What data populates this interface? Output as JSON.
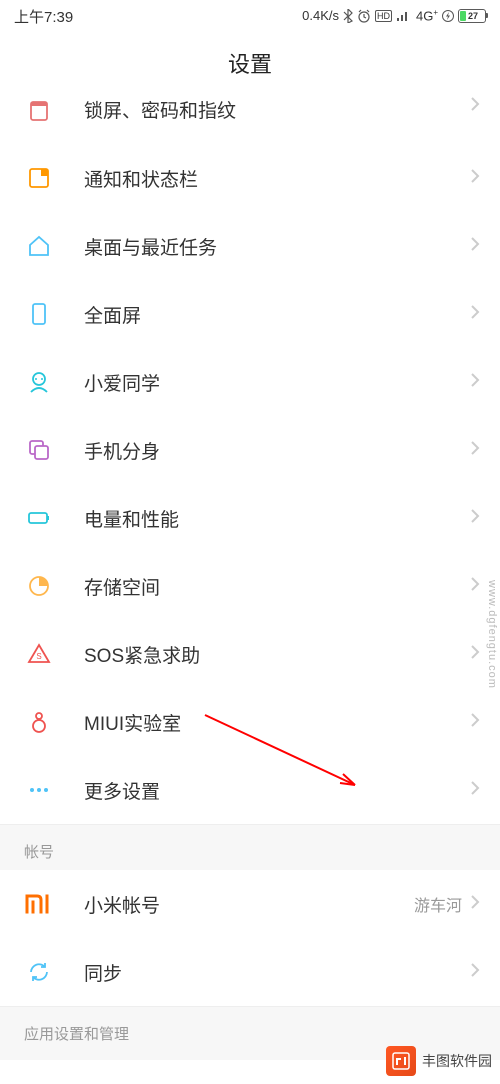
{
  "status": {
    "time": "上午7:39",
    "speed": "0.4K/s",
    "signal": "4G",
    "battery_pct": "27"
  },
  "header": {
    "title": "设置"
  },
  "items": [
    {
      "icon": "lock",
      "color": "#e57373",
      "label": "锁屏、密码和指纹"
    },
    {
      "icon": "notification",
      "color": "#ff9800",
      "label": "通知和状态栏"
    },
    {
      "icon": "home",
      "color": "#4fc3f7",
      "label": "桌面与最近任务"
    },
    {
      "icon": "fullscreen",
      "color": "#4fc3f7",
      "label": "全面屏"
    },
    {
      "icon": "xiaoai",
      "color": "#26c6da",
      "label": "小爱同学"
    },
    {
      "icon": "dual",
      "color": "#ba68c8",
      "label": "手机分身"
    },
    {
      "icon": "battery-perf",
      "color": "#26c6da",
      "label": "电量和性能"
    },
    {
      "icon": "storage",
      "color": "#ffb74d",
      "label": "存储空间"
    },
    {
      "icon": "sos",
      "color": "#ef5350",
      "label": "SOS紧急求助"
    },
    {
      "icon": "lab",
      "color": "#ef5350",
      "label": "MIUI实验室"
    },
    {
      "icon": "more",
      "color": "#4fc3f7",
      "label": "更多设置"
    }
  ],
  "section_account": "帐号",
  "account_items": [
    {
      "icon": "mi",
      "color": "#ff6f00",
      "label": "小米帐号",
      "value": "游车河"
    },
    {
      "icon": "sync",
      "color": "#4fc3f7",
      "label": "同步"
    }
  ],
  "section_apps": "应用设置和管理",
  "watermark": "www.dgfengtu.com",
  "brand": "丰图软件园"
}
